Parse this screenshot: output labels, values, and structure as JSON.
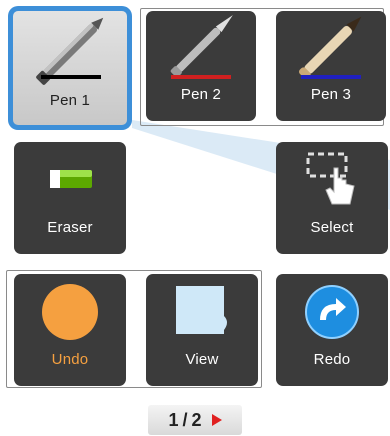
{
  "tools": {
    "pen1": {
      "label": "Pen 1",
      "stroke_color": "#000000",
      "selected": true
    },
    "pen2": {
      "label": "Pen 2",
      "stroke_color": "#d02020"
    },
    "pen3": {
      "label": "Pen 3",
      "stroke_color": "#2020c0"
    },
    "eraser": {
      "label": "Eraser"
    },
    "select": {
      "label": "Select"
    },
    "undo": {
      "label": "Undo",
      "label_color": "#f5a040"
    },
    "view": {
      "label": "View"
    },
    "redo": {
      "label": "Redo"
    }
  },
  "pager": {
    "current": "1",
    "separator": "/",
    "total": "2"
  },
  "colors": {
    "selection_blue": "#3d8fd8",
    "tile_dark": "#3b3b3b",
    "undo_orange": "#f5a040",
    "view_lightblue": "#cfe8f8",
    "redo_blue": "#1e8ee0",
    "pager_arrow": "#e02020"
  }
}
